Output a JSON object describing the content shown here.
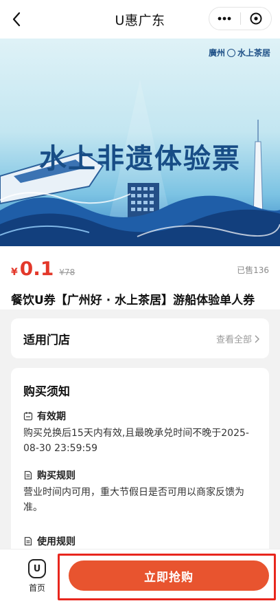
{
  "nav": {
    "title": "U惠广东",
    "more_icon": "ellipsis-icon",
    "close_icon": "close-circle-icon",
    "back_icon": "chevron-left-icon"
  },
  "banner": {
    "title": "水上非遗体验票",
    "logo_text": "廣州",
    "logo_text_2": "水上茶居"
  },
  "product": {
    "currency": "¥",
    "price": "0.1",
    "original_price": "¥78",
    "sold": "已售136",
    "title": "餐饮U券【广州好 · 水上茶居】游船体验单人券"
  },
  "stores": {
    "label": "适用门店",
    "see_all": "查看全部"
  },
  "notice": {
    "title": "购买须知",
    "sections": [
      {
        "heading": "有效期",
        "icon": "calendar-icon",
        "body": "购买兑换后15天内有效,且最晚承兑时间不晚于2025-08-30 23:59:59"
      },
      {
        "heading": "购买规则",
        "icon": "document-icon",
        "body": "营业时间内可用，重大节假日是否可用以商家反馈为准。"
      },
      {
        "heading": "使用规则",
        "icon": "document-icon",
        "body": ""
      }
    ]
  },
  "bottom": {
    "home_label": "首页",
    "home_icon_text": "U",
    "buy_label": "立即抢购"
  },
  "colors": {
    "accent": "#e8542f",
    "price": "#e3382a",
    "highlight_box": "#e8261d",
    "banner_title": "#184d86"
  }
}
